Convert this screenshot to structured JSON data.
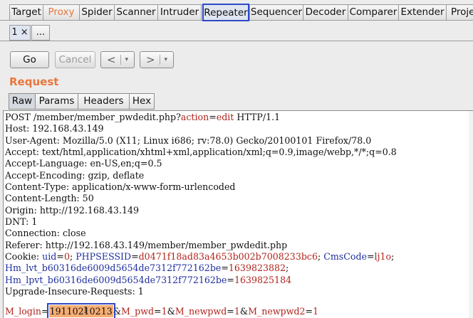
{
  "main_tabs": [
    {
      "label": "Target"
    },
    {
      "label": "Proxy"
    },
    {
      "label": "Spider"
    },
    {
      "label": "Scanner"
    },
    {
      "label": "Intruder"
    },
    {
      "label": "Repeater"
    },
    {
      "label": "Sequencer"
    },
    {
      "label": "Decoder"
    },
    {
      "label": "Comparer"
    },
    {
      "label": "Extender"
    },
    {
      "label": "Proje"
    }
  ],
  "sub_tabs": [
    {
      "label": "1 ×"
    },
    {
      "label": "..."
    }
  ],
  "toolbar": {
    "go_label": "Go",
    "cancel_label": "Cancel",
    "back_arrow": "<",
    "forward_arrow": ">",
    "caret": "▾"
  },
  "request": {
    "title": "Request",
    "view_tabs": [
      {
        "label": "Raw"
      },
      {
        "label": "Params"
      },
      {
        "label": "Headers"
      },
      {
        "label": "Hex"
      }
    ],
    "request_line": {
      "prefix": "POST /member/member_pwdedit.php?",
      "param_name": "action",
      "eq": "=",
      "param_value": "edit",
      "suffix": " HTTP/1.1"
    },
    "headers": [
      "Host: 192.168.43.149",
      "User-Agent: Mozilla/5.0 (X11; Linux i686; rv:78.0) Gecko/20100101 Firefox/78.0",
      "Accept: text/html,application/xhtml+xml,application/xml;q=0.9,image/webp,*/*;q=0.8",
      "Accept-Language: en-US,en;q=0.5",
      "Accept-Encoding: gzip, deflate",
      "Content-Type: application/x-www-form-urlencoded",
      "Content-Length: 50",
      "Origin: http://192.168.43.149",
      "DNT: 1",
      "Connection: close",
      "Referer: http://192.168.43.149/member/member_pwdedit.php"
    ],
    "cookie": {
      "label": "Cookie: ",
      "c1_name": "uid",
      "c1_value": "0",
      "c2_name": "PHPSESSID",
      "c2_value": "d0471f18ad83a4653b002b7008233bc6",
      "c3_name": "CmsCode",
      "c3_value": "lj1o",
      "c4_name": "Hm_lvt_b60316de6009d5654de7312f772162be",
      "c4_value": "1639823882",
      "c5_name": "Hm_lpvt_b60316de6009d5654de7312f772162be",
      "c5_value": "1639825184"
    },
    "upgrade_header": "Upgrade-Insecure-Requests: 1",
    "body": {
      "p1_name": "M_login",
      "p1_value": "19110210213",
      "p2_name": "M_pwd",
      "p2_value": "1",
      "p3_name": "M_newpwd",
      "p3_value": "1",
      "p4_name": "M_newpwd2",
      "p4_value": "1"
    }
  },
  "colors": {
    "accent_orange": "#e8763c",
    "active_tab_border": "#2f49c6",
    "cookie_name": "#1f2f9e",
    "cookie_value": "#b0241c",
    "highlight": "#f6ad73"
  }
}
